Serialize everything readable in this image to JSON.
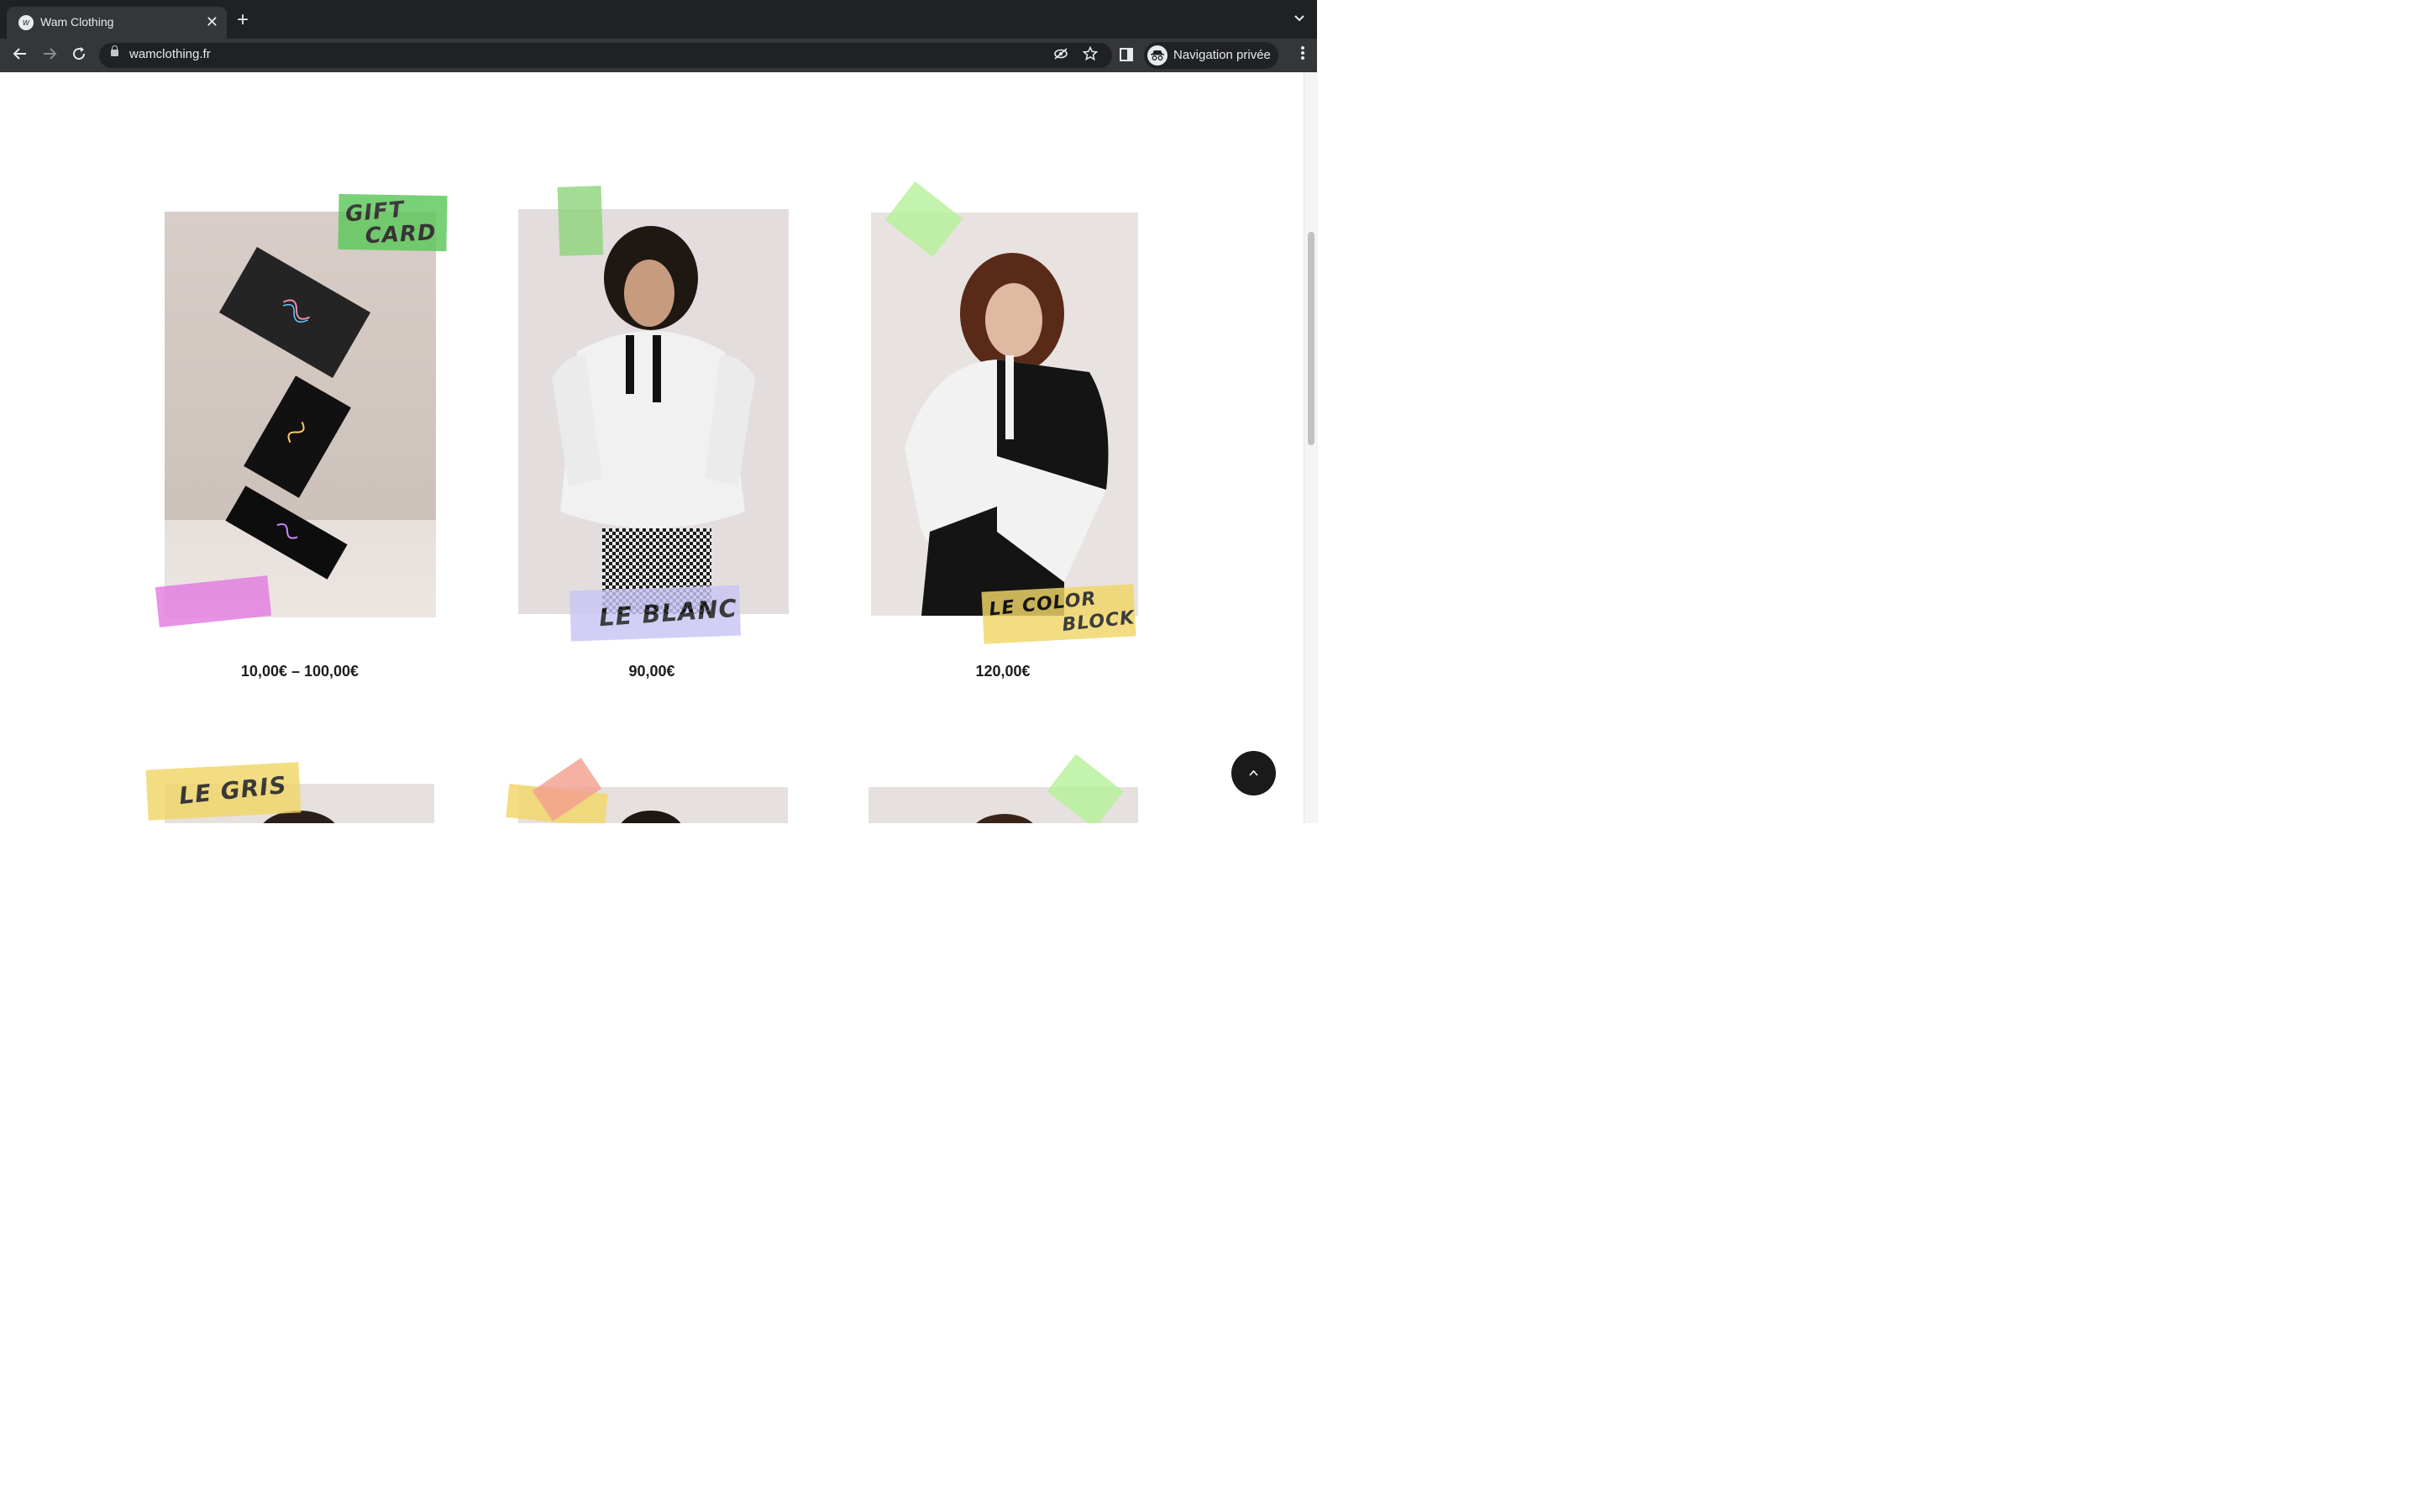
{
  "browser": {
    "tab_title": "Wam Clothing",
    "favicon_letter": "w",
    "close_glyph": "✕",
    "new_tab_glyph": "+",
    "tab_menu_glyph": "⌄",
    "url": "wamclothing.fr",
    "profile_label": "Navigation privée",
    "icons": [
      "back-icon",
      "forward-icon",
      "reload-icon",
      "lock-icon",
      "eye-off-icon",
      "star-icon",
      "side-panel-icon",
      "incognito-icon",
      "kebab-menu-icon"
    ]
  },
  "products": [
    {
      "tape_label_1": "GIFT",
      "tape_label_2": "CARD",
      "price": "10,00€ – 100,00€",
      "tape_color": "#5cc85a",
      "corner_tape_color": "#e27be0"
    },
    {
      "tape_label_1": "LE BLANC",
      "tape_label_2": "",
      "price": "90,00€",
      "tape_color": "#c9c5f6",
      "corner_tape_color": "#8fd47c"
    },
    {
      "tape_label_1": "LE COLOR",
      "tape_label_2": "BLOCK",
      "price": "120,00€",
      "tape_color": "#f1d667",
      "corner_tape_color": "#b6f09a"
    }
  ],
  "next_row": [
    {
      "tape_label": "LE GRIS",
      "tape_color": "#f1d667"
    },
    {
      "tape_label": "",
      "tape_color": "#f3a08f"
    },
    {
      "tape_label": "",
      "tape_color": "#b6f09a"
    }
  ],
  "colors": {
    "chrome_dark": "#202124",
    "chrome_tab": "#35363a",
    "text": "#1d1d1d",
    "back_to_top": "#1a1a1a"
  }
}
